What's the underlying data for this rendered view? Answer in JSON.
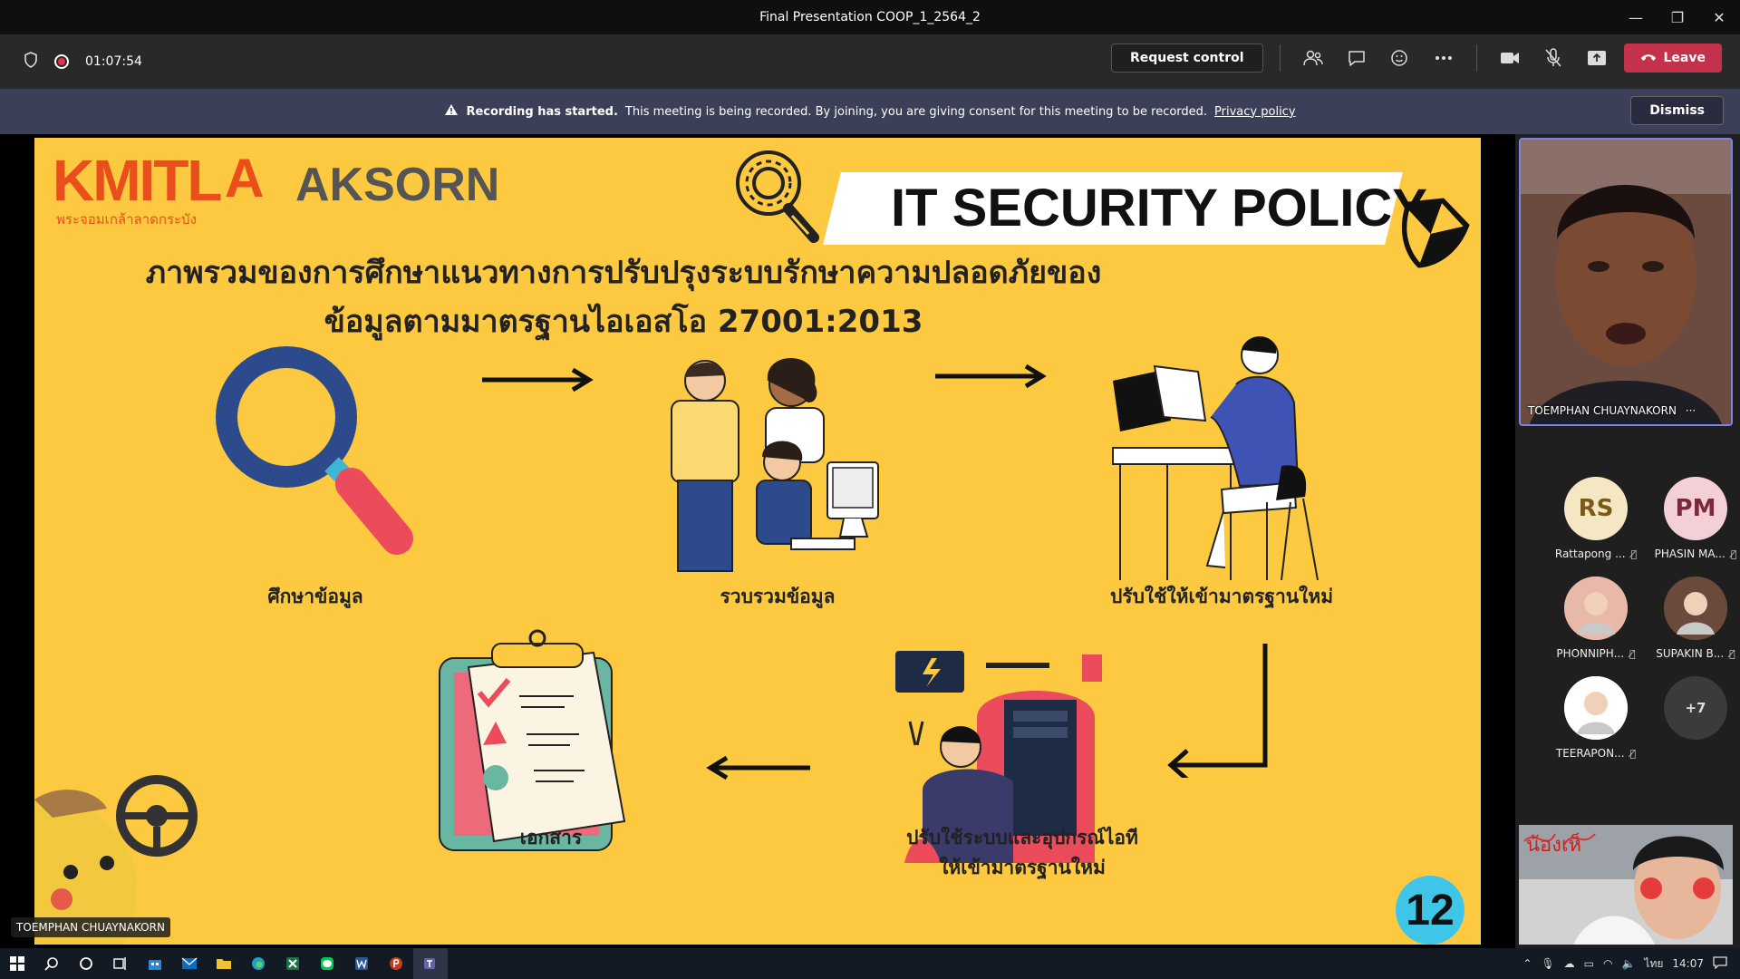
{
  "window": {
    "title": "Final Presentation COOP_1_2564_2",
    "minimize": "—",
    "restore": "❐",
    "close": "✕"
  },
  "toolbar": {
    "timer": "01:07:54",
    "request_control": "Request control",
    "leave": "Leave",
    "icons": [
      "people-icon",
      "chat-icon",
      "reactions-icon",
      "more-icon",
      "camera-icon",
      "mic-off-icon",
      "share-icon"
    ]
  },
  "banner": {
    "strong": "Recording has started.",
    "text": "This meeting is being recorded. By joining, you are giving consent for this meeting to be recorded.",
    "link": "Privacy policy",
    "dismiss": "Dismiss"
  },
  "slide": {
    "logo_kmitl": "KMITL",
    "logo_kmitl_sub": "พระจอมเกล้าลาดกระบัง",
    "logo_aksorn": "AKSORN",
    "banner_title": "IT SECURITY POLICY",
    "title_line1": "ภาพรวมของการศึกษาแนวทางการปรับปรุงระบบรักษาความปลอดภัยของ",
    "title_line2": "ข้อมูลตามมาตรฐานไอเอสโอ 27001:2013",
    "step1": "ศึกษาข้อมูล",
    "step2": "รวบรวมข้อมูล",
    "step3": "ปรับใช้ให้เข้ามาตรฐานใหม่",
    "step4_line1": "ปรับใช้ระบบและอุปกรณ์ไอที",
    "step4_line2": "ให้เข้ามาตรฐานใหม่",
    "step5": "เอกสาร",
    "page_number": "12",
    "presenter_label": "TOEMPHAN CHUAYNAKORN"
  },
  "participants": {
    "main_tile": "TOEMPHAN CHUAYNAKORN",
    "list": [
      {
        "initials": "RS",
        "name": "Rattapong ...",
        "color": "#f6e7c4",
        "text": "#7a5a1a"
      },
      {
        "initials": "PM",
        "name": "PHASIN MA...",
        "color": "#f3d0d6",
        "text": "#7a2a3a"
      },
      {
        "initials": "",
        "name": "PHONNIPH...",
        "color": "#e8b8a8",
        "text": "#000"
      },
      {
        "initials": "",
        "name": "SUPAKIN B...",
        "color": "#6a4a3a",
        "text": "#000"
      },
      {
        "initials": "",
        "name": "TEERAPON...",
        "color": "#ffffff",
        "text": "#000"
      },
      {
        "initials": "+7",
        "name": "",
        "color": "#3b3b3b",
        "text": "#ddd"
      }
    ],
    "self_video_text": "น้องเห็"
  },
  "taskbar": {
    "time": "14:07",
    "lang": "ไทย"
  }
}
